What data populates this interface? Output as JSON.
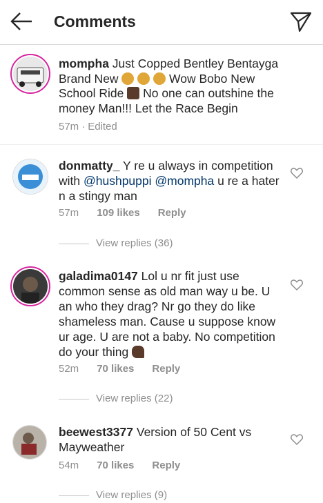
{
  "header": {
    "title": "Comments"
  },
  "caption": {
    "username": "mompha",
    "text_1": " Just Copped Bentley Bentayga Brand New ",
    "text_2": " Wow Bobo New School Ride ",
    "text_3": " No one can outshine the money Man!!! Let the Race Begin",
    "time": "57m",
    "separator": "·",
    "edited": "Edited"
  },
  "comments": [
    {
      "username": "donmatty_",
      "text_1": " Y re u always in competition with ",
      "mention_1": "@hushpuppi",
      "mention_2": "@mompha",
      "text_2": " u re a hater n a stingy man",
      "time": "57m",
      "likes": "109 likes",
      "reply": "Reply",
      "view_replies": "View replies (36)"
    },
    {
      "username": "galadima0147",
      "text": " Lol u nr fit just use common sense as old man way u be. U an who they drag? Nr go they do like shameless man. Cause u suppose know ur age. U are not a baby. No competition do your thing ",
      "time": "52m",
      "likes": "70 likes",
      "reply": "Reply",
      "view_replies": "View replies (22)"
    },
    {
      "username": "beewest3377",
      "text": " Version of 50 Cent vs Mayweather",
      "time": "54m",
      "likes": "70 likes",
      "reply": "Reply",
      "view_replies": "View replies (9)"
    }
  ],
  "icons": {
    "back": "back-arrow-icon",
    "send": "paper-plane-icon",
    "heart": "heart-outline-icon",
    "money_bag": "money-bag-emoji",
    "praying_hands": "praying-hands-emoji",
    "flexed_biceps": "flexed-biceps-emoji"
  },
  "colors": {
    "mention": "#003569",
    "secondary": "#8e8e8e",
    "ring": "#d6249f"
  }
}
